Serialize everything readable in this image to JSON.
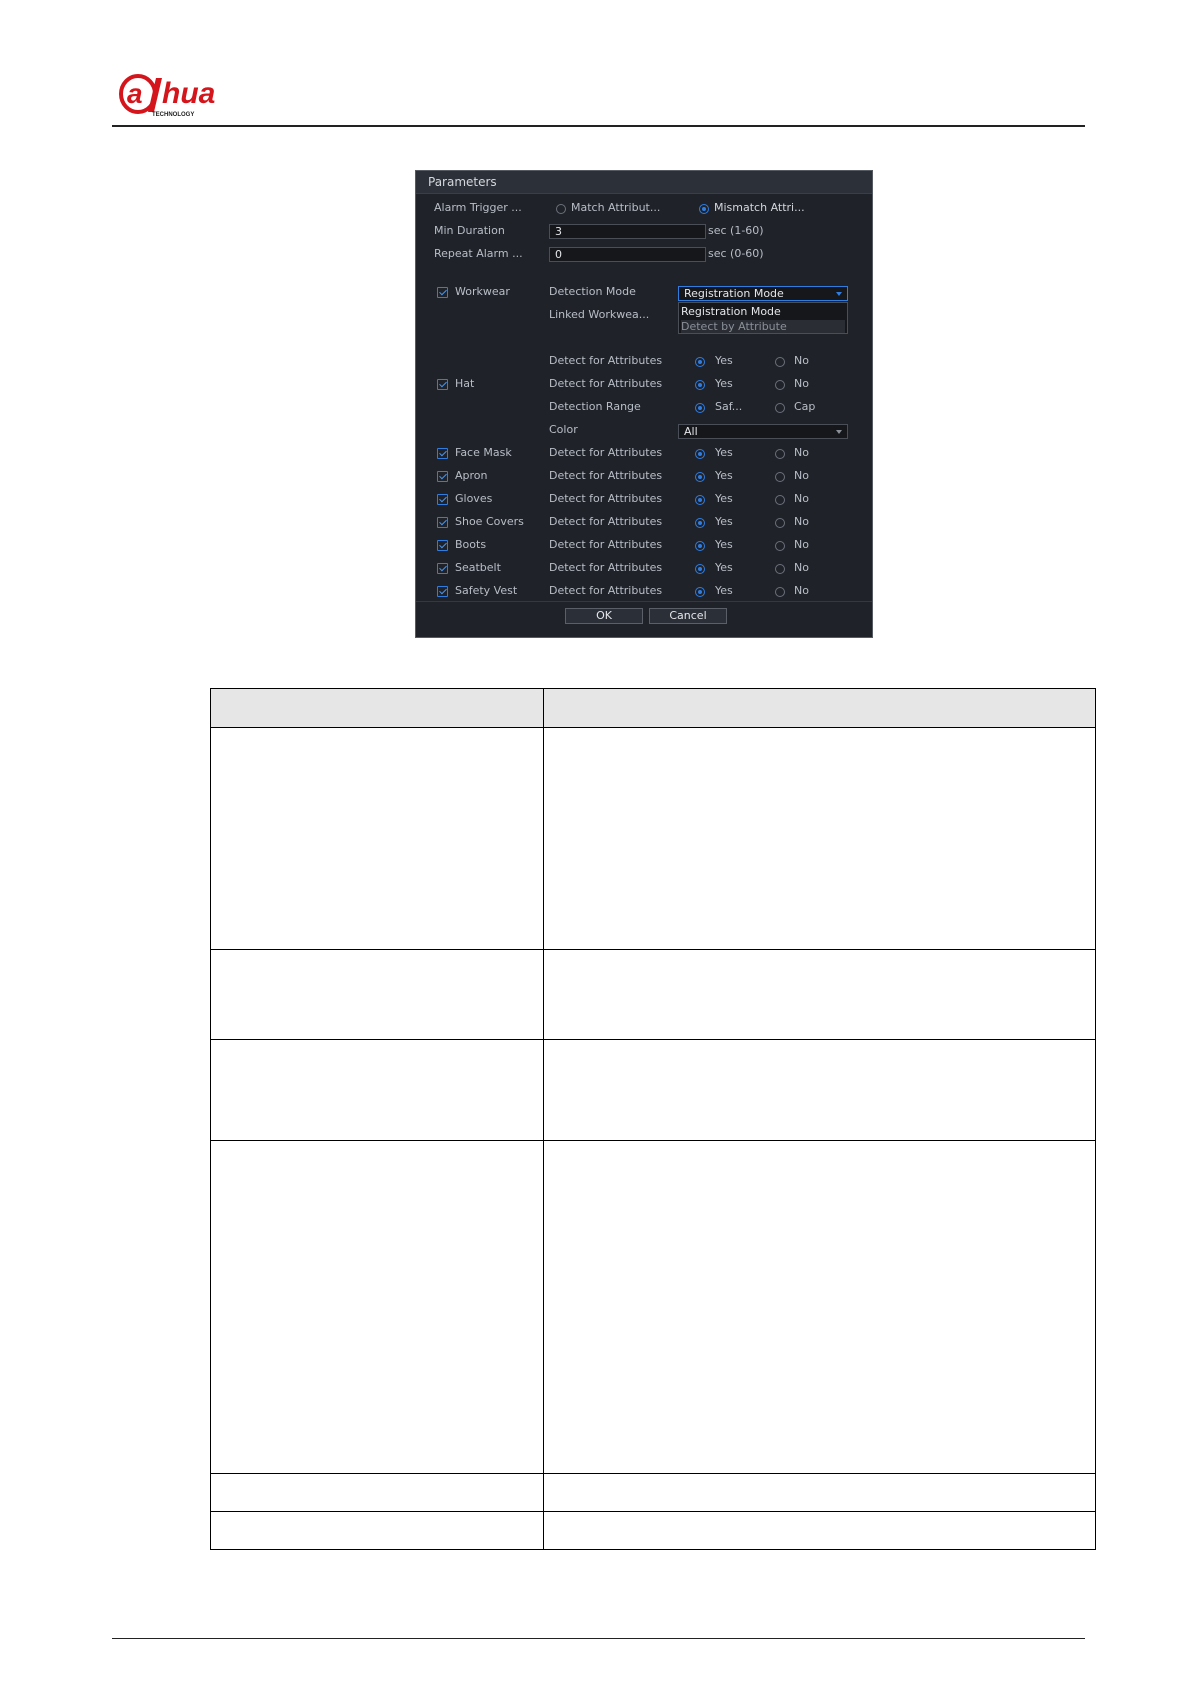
{
  "brand": {
    "logo_text": "alhua",
    "logo_sub": "TECHNOLOGY",
    "logo_color": "#d4151c"
  },
  "dialog": {
    "title": "Parameters",
    "alarm_trigger": {
      "label": "Alarm Trigger ...",
      "opt1": "Match Attribut...",
      "opt2": "Mismatch Attri...",
      "selected": "Mismatch Attri..."
    },
    "min_duration": {
      "label": "Min Duration",
      "value": "3",
      "unit": "sec (1-60)"
    },
    "repeat_alarm": {
      "label": "Repeat Alarm ...",
      "value": "0",
      "unit": "sec (0-60)"
    },
    "workwear": {
      "label": "Workwear",
      "detection_mode_label": "Detection Mode",
      "detection_mode_value": "Registration Mode",
      "dropdown_options": [
        "Registration Mode",
        "Detect by Attribute"
      ],
      "linked_label": "Linked Workwea..."
    },
    "hat": {
      "label": "Hat",
      "row1_label": "Detect for Attributes",
      "row1_yes": "Yes",
      "row1_no": "No",
      "row2_label": "Detect for Attributes",
      "row2_yes": "Yes",
      "row2_no": "No",
      "range_label": "Detection Range",
      "range_opt1": "Saf...",
      "range_opt2": "Cap",
      "color_label": "Color",
      "color_value": "All"
    },
    "items": [
      {
        "label": "Face Mask",
        "attr": "Detect for Attributes",
        "yes": "Yes",
        "no": "No"
      },
      {
        "label": "Apron",
        "attr": "Detect for Attributes",
        "yes": "Yes",
        "no": "No"
      },
      {
        "label": "Gloves",
        "attr": "Detect for Attributes",
        "yes": "Yes",
        "no": "No"
      },
      {
        "label": "Shoe Covers",
        "attr": "Detect for Attributes",
        "yes": "Yes",
        "no": "No"
      },
      {
        "label": "Boots",
        "attr": "Detect for Attributes",
        "yes": "Yes",
        "no": "No"
      },
      {
        "label": "Seatbelt",
        "attr": "Detect for Attributes",
        "yes": "Yes",
        "no": "No"
      },
      {
        "label": "Safety Vest",
        "attr": "Detect for Attributes",
        "yes": "Yes",
        "no": "No"
      }
    ],
    "ok_label": "OK",
    "cancel_label": "Cancel"
  }
}
